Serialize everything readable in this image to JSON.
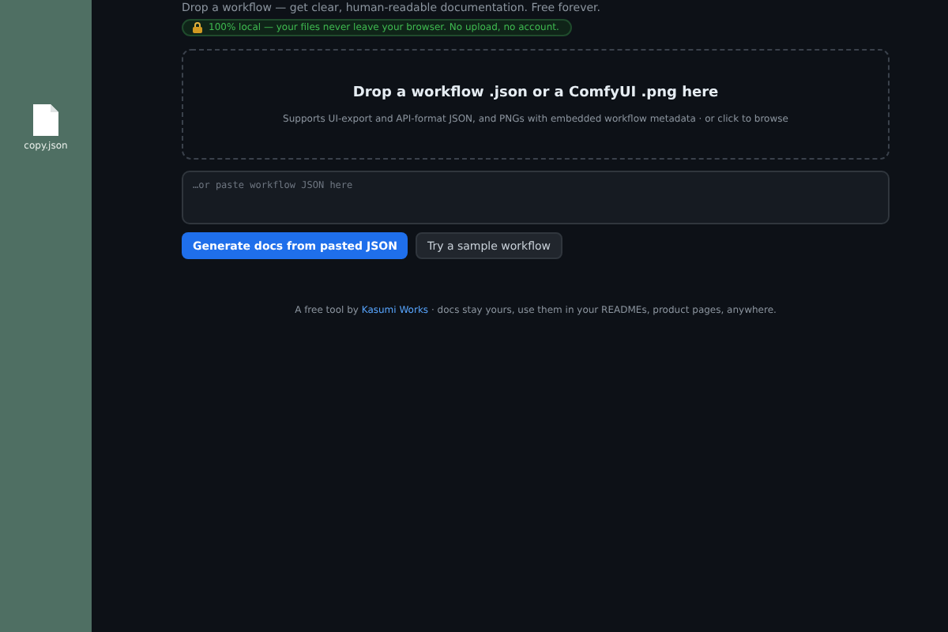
{
  "desktop": {
    "file": {
      "label": "copy.json"
    }
  },
  "page": {
    "intro": "Drop a workflow — get clear, human-readable documentation. Free forever.",
    "badge": "100% local — your files never leave your browser. No upload, no account.",
    "dropzone": {
      "title": "Drop a workflow .json or a ComfyUI .png here",
      "hint": "Supports UI-export and API-format JSON, and PNGs with embedded workflow metadata · or click to browse"
    },
    "paste_field": {
      "placeholder": "…or paste workflow JSON here"
    },
    "buttons": [
      {
        "label": "Generate docs from pasted JSON",
        "kind": "primary"
      },
      {
        "label": "Try a sample workflow",
        "kind": "secondary"
      }
    ],
    "footer": {
      "before": "A free tool by",
      "link": "Kasumi Works",
      "after": "· docs stay yours, use them in your READMEs, product pages, anywhere."
    }
  }
}
